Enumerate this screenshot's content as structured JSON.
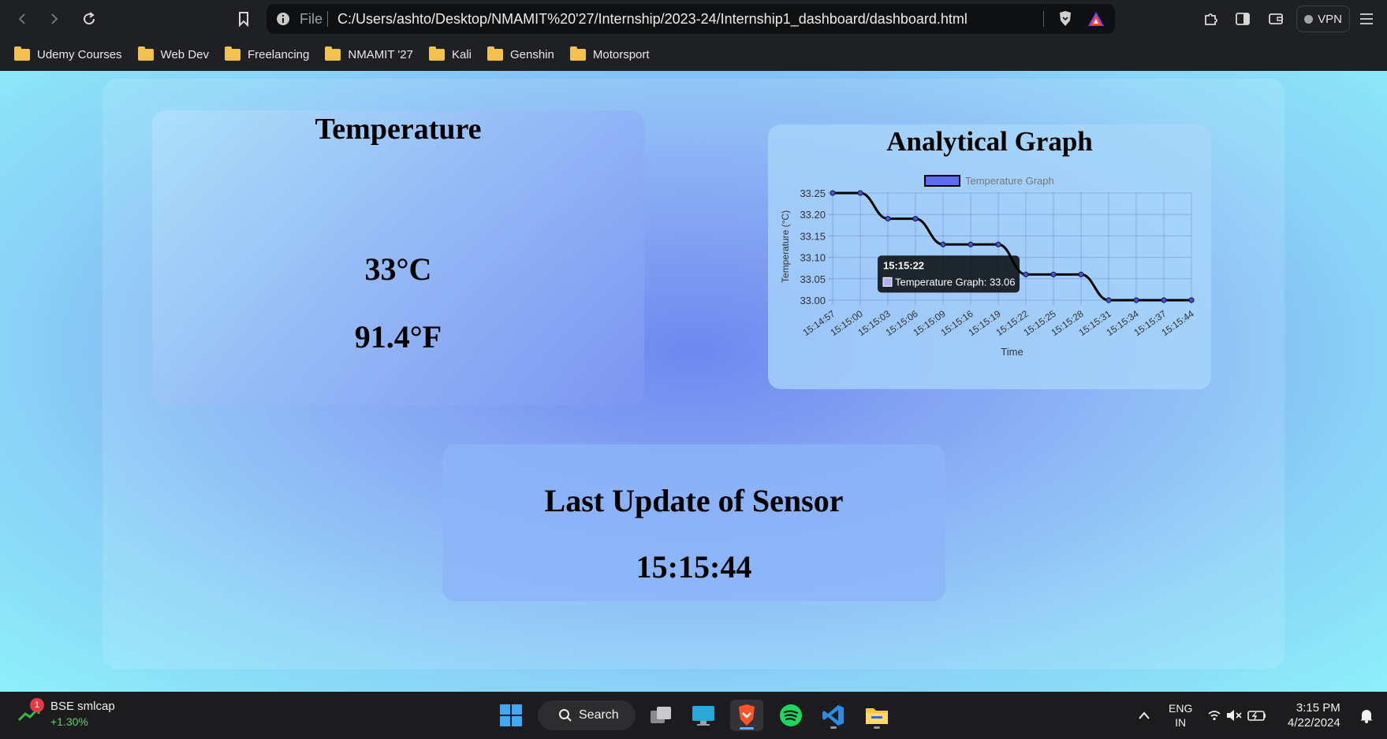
{
  "browser": {
    "omnibox_scheme": "File",
    "url": "C:/Users/ashto/Desktop/NMAMIT%20'27/Internship/2023-24/Internship1_dashboard/dashboard.html",
    "vpn_label": "VPN"
  },
  "bookmarks": [
    "Udemy Courses",
    "Web Dev",
    "Freelancing",
    "NMAMIT '27",
    "Kali",
    "Genshin",
    "Motorsport"
  ],
  "page": {
    "temperature_title": "Temperature",
    "temperature_c": "33°C",
    "temperature_f": "91.4°F",
    "graph_title": "Analytical Graph",
    "last_update_title": "Last Update of Sensor",
    "last_update_time": "15:15:44"
  },
  "chart_data": {
    "type": "line",
    "legend": "Temperature Graph",
    "xlabel": "Time",
    "ylabel": "Temperature (°C)",
    "x": [
      "15:14:57",
      "15:15:00",
      "15:15:03",
      "15:15:06",
      "15:15:09",
      "15:15:16",
      "15:15:19",
      "15:15:22",
      "15:15:25",
      "15:15:28",
      "15:15:31",
      "15:15:34",
      "15:15:37",
      "15:15:44"
    ],
    "values": [
      33.25,
      33.25,
      33.19,
      33.19,
      33.13,
      33.13,
      33.13,
      33.06,
      33.06,
      33.06,
      33.0,
      33.0,
      33.0,
      33.0
    ],
    "yticks": [
      "33.25",
      "33.20",
      "33.15",
      "33.10",
      "33.05",
      "33.00"
    ],
    "ylim": [
      33.0,
      33.25
    ],
    "grid": true,
    "legend_placement": "top",
    "line_color": "#000000",
    "legend_fill": "#5b6cf0",
    "tooltip": {
      "title": "15:15:22",
      "label": "Temperature Graph: 33.06"
    }
  },
  "taskbar": {
    "stock_name": "BSE smlcap",
    "stock_change": "+1.30%",
    "stock_badge": "1",
    "search_label": "Search",
    "lang_line1": "ENG",
    "lang_line2": "IN",
    "time": "3:15 PM",
    "date": "4/22/2024"
  }
}
